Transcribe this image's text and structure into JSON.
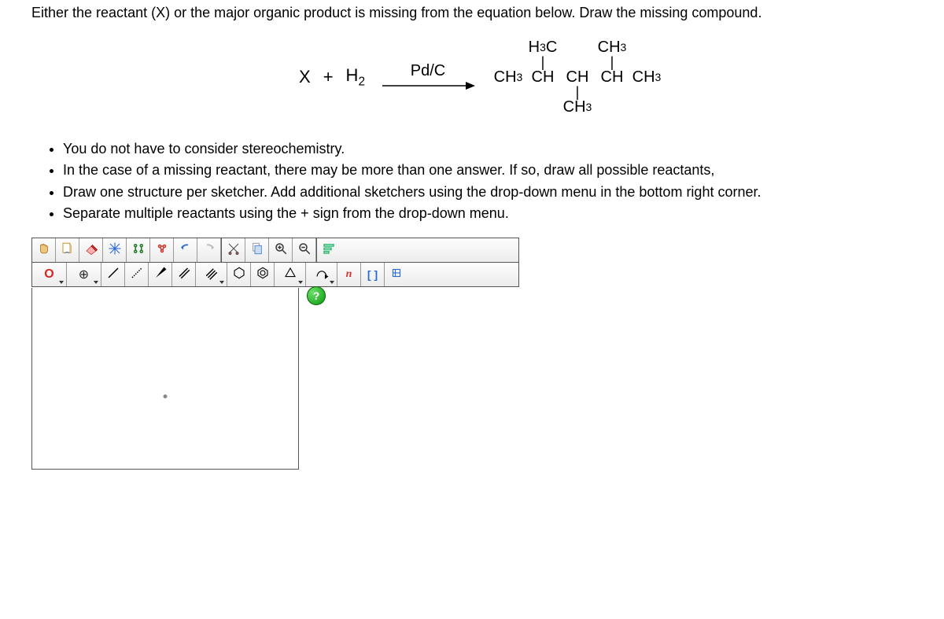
{
  "question": {
    "prompt": "Either the reactant (X) or the major organic product is missing from the equation below. Draw the missing compound."
  },
  "equation": {
    "reactant_x": "X",
    "plus": "+",
    "h2": "H",
    "h2_sub": "2",
    "arrow_label": "Pd/C",
    "product": {
      "top_left": "H₃C",
      "top_right": "CH₃",
      "backbone": "CH₃CHCHCHCH₃",
      "bottom": "CH₃"
    }
  },
  "instructions": {
    "items": [
      "You do not have to consider stereochemistry.",
      "In the case of a missing reactant, there may be more than one answer. If so, draw all possible reactants,",
      "Draw one structure per sketcher. Add additional sketchers using the drop-down menu in the bottom right corner.",
      "Separate multiple reactants using the + sign from the drop-down menu."
    ]
  },
  "toolbar": {
    "row1": {
      "hand": "hand-icon",
      "open": "open-icon",
      "erase": "eraser-icon",
      "clear": "clear-icon",
      "clean": "clean-icon",
      "center": "center-icon",
      "undo": "undo-icon",
      "redo": "redo-icon",
      "copy": "copy-icon",
      "paste": "paste-icon",
      "zoomin": "zoom-in-icon",
      "zoomout": "zoom-out-icon",
      "settings": "settings-icon"
    },
    "row2": {
      "atom": "O",
      "charge": "⊕",
      "single": "single-bond-icon",
      "recess": "recessed-bond-icon",
      "wedge": "wedge-bond-icon",
      "double": "double-bond-icon",
      "triple": "triple-bond-icon",
      "ring1": "cyclohexane-icon",
      "ring2": "benzene-icon",
      "ring3": "cycloprop-icon",
      "arrow": "reaction-arrow-icon",
      "text_n": "n",
      "bracket": "[ ]",
      "misc": "misc-icon"
    }
  },
  "help": {
    "label": "?"
  }
}
